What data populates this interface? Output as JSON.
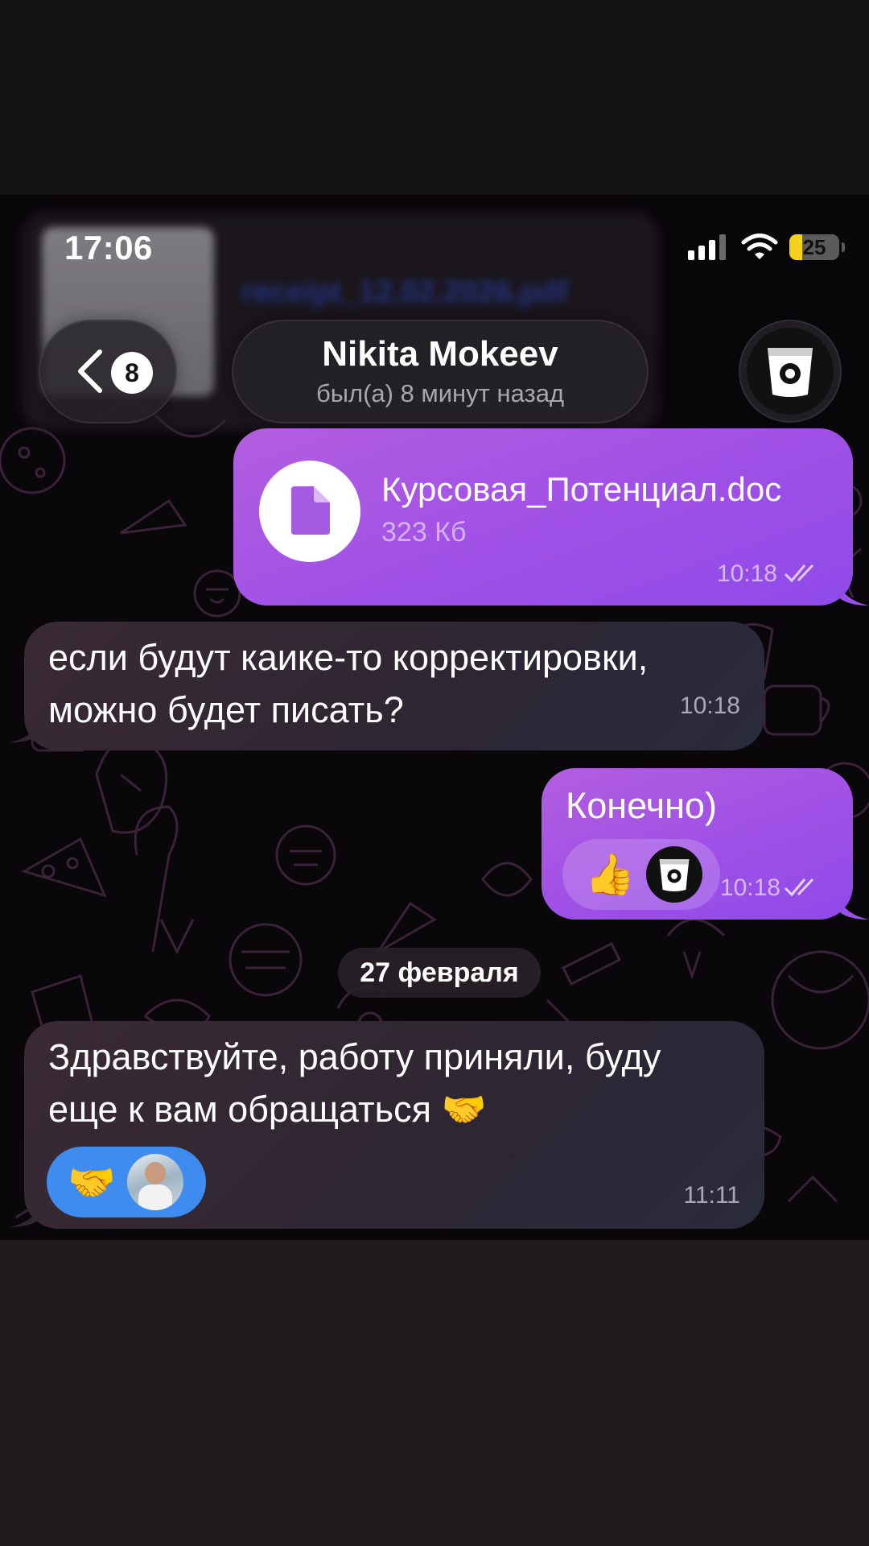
{
  "status_bar": {
    "time": "17:06",
    "battery": "25",
    "battery_level": 0.25,
    "icons": [
      "signal-icon",
      "wifi-icon",
      "battery-icon"
    ]
  },
  "header": {
    "unread_count": "8",
    "contact_name": "Nikita Mokeev",
    "contact_status": "был(а) 8 минут назад",
    "back_icon": "chevron-left-icon",
    "avatar_icon": "bucket-logo-icon"
  },
  "messages": [
    {
      "direction": "outgoing",
      "type": "file",
      "file_name": "Курсовая_Потенциал.doc",
      "file_size": "323 Кб",
      "time": "10:18",
      "read": true
    },
    {
      "direction": "incoming",
      "type": "text",
      "lines": [
        "если будут каике-то корректировки,",
        "можно будет писать?"
      ],
      "time": "10:18"
    },
    {
      "direction": "outgoing",
      "type": "text",
      "text": "Конечно)",
      "time": "10:18",
      "read": true,
      "reaction": {
        "emoji": "👍",
        "avatar": "bucket-logo-icon"
      }
    },
    {
      "direction": "incoming",
      "type": "text",
      "lines": [
        "Здравствуйте, работу приняли, буду",
        "еще к вам обращаться 🤝"
      ],
      "time": "11:11",
      "reaction": {
        "emoji": "🤝",
        "avatar": "user-photo-avatar"
      }
    }
  ],
  "date_separator": "27 февраля",
  "colors": {
    "outgoing_bubble": "#9f50e6",
    "incoming_bubble": "#2d2633",
    "reaction_blue": "#3f8cf0",
    "battery_yellow": "#f5d21a"
  }
}
